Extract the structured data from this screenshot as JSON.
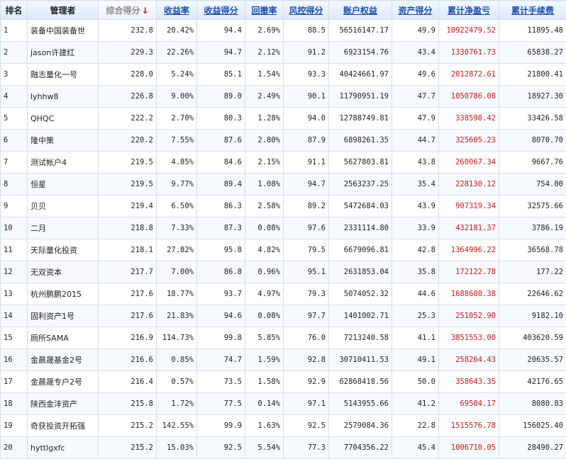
{
  "header": {
    "rank": "排名",
    "manager": "管理者",
    "score": "综合得分",
    "score_arrow": "↓",
    "return_rate": "收益率",
    "return_score": "收益得分",
    "drawdown": "回撤率",
    "risk_score": "风控得分",
    "equity": "账户权益",
    "asset_score": "资产得分",
    "net_pnl": "累计净盈亏",
    "fees": "累计手续费"
  },
  "rows": [
    {
      "rank": "1",
      "name": "装备中国装备世",
      "score": "232.8",
      "ret": "20.42%",
      "ret_score": "94.4",
      "dd": "2.69%",
      "risk": "88.5",
      "equity": "56516147.17",
      "asset": "49.9",
      "pnl": "10922479.52",
      "fee": "11895.48"
    },
    {
      "rank": "2",
      "name": "jason许建红",
      "score": "229.3",
      "ret": "22.26%",
      "ret_score": "94.7",
      "dd": "2.12%",
      "risk": "91.2",
      "equity": "6923154.76",
      "asset": "43.4",
      "pnl": "1330761.73",
      "fee": "65838.27"
    },
    {
      "rank": "3",
      "name": "融志量化一号",
      "score": "228.0",
      "ret": "5.24%",
      "ret_score": "85.1",
      "dd": "1.54%",
      "risk": "93.3",
      "equity": "40424661.97",
      "asset": "49.6",
      "pnl": "2012872.61",
      "fee": "21800.41"
    },
    {
      "rank": "4",
      "name": "lyhhw8",
      "score": "226.8",
      "ret": "9.00%",
      "ret_score": "89.0",
      "dd": "2.49%",
      "risk": "90.1",
      "equity": "11790951.19",
      "asset": "47.7",
      "pnl": "1050786.08",
      "fee": "18927.30"
    },
    {
      "rank": "5",
      "name": "QHQC",
      "score": "222.2",
      "ret": "2.70%",
      "ret_score": "80.3",
      "dd": "1.28%",
      "risk": "94.0",
      "equity": "12788749.81",
      "asset": "47.9",
      "pnl": "338598.42",
      "fee": "33426.58"
    },
    {
      "rank": "6",
      "name": "隆中策",
      "score": "220.2",
      "ret": "7.55%",
      "ret_score": "87.6",
      "dd": "2.80%",
      "risk": "87.9",
      "equity": "6898261.35",
      "asset": "44.7",
      "pnl": "325605.23",
      "fee": "8070.70"
    },
    {
      "rank": "7",
      "name": "测试帐户4",
      "score": "219.5",
      "ret": "4.85%",
      "ret_score": "84.6",
      "dd": "2.15%",
      "risk": "91.1",
      "equity": "5627803.81",
      "asset": "43.8",
      "pnl": "260067.34",
      "fee": "9667.76"
    },
    {
      "rank": "8",
      "name": "恒星",
      "score": "219.5",
      "ret": "9.77%",
      "ret_score": "89.4",
      "dd": "1.08%",
      "risk": "94.7",
      "equity": "2563237.25",
      "asset": "35.4",
      "pnl": "228130.12",
      "fee": "754.00"
    },
    {
      "rank": "9",
      "name": "贝贝",
      "score": "219.4",
      "ret": "6.50%",
      "ret_score": "86.3",
      "dd": "2.58%",
      "risk": "89.2",
      "equity": "5472684.03",
      "asset": "43.9",
      "pnl": "907319.34",
      "fee": "32575.66"
    },
    {
      "rank": "10",
      "name": "二月",
      "score": "218.8",
      "ret": "7.33%",
      "ret_score": "87.3",
      "dd": "0.08%",
      "risk": "97.6",
      "equity": "2331114.80",
      "asset": "33.9",
      "pnl": "432181.37",
      "fee": "3786.19"
    },
    {
      "rank": "11",
      "name": "天际量化投资",
      "score": "218.1",
      "ret": "27.82%",
      "ret_score": "95.8",
      "dd": "4.82%",
      "risk": "79.5",
      "equity": "6679096.81",
      "asset": "42.8",
      "pnl": "1364996.22",
      "fee": "36568.78"
    },
    {
      "rank": "12",
      "name": "无双资本",
      "score": "217.7",
      "ret": "7.00%",
      "ret_score": "86.8",
      "dd": "0.96%",
      "risk": "95.1",
      "equity": "2631853.04",
      "asset": "35.8",
      "pnl": "172122.78",
      "fee": "177.22"
    },
    {
      "rank": "13",
      "name": "杭州鹏鹏2015",
      "score": "217.6",
      "ret": "18.77%",
      "ret_score": "93.7",
      "dd": "4.97%",
      "risk": "79.3",
      "equity": "5074052.32",
      "asset": "44.6",
      "pnl": "1688608.38",
      "fee": "22646.62"
    },
    {
      "rank": "14",
      "name": "固利资产1号",
      "score": "217.6",
      "ret": "21.83%",
      "ret_score": "94.6",
      "dd": "0.08%",
      "risk": "97.7",
      "equity": "1401002.71",
      "asset": "25.3",
      "pnl": "251052.90",
      "fee": "9182.10"
    },
    {
      "rank": "15",
      "name": "厕所SAMA",
      "score": "216.9",
      "ret": "114.73%",
      "ret_score": "99.8",
      "dd": "5.85%",
      "risk": "76.0",
      "equity": "7213240.58",
      "asset": "41.1",
      "pnl": "3851553.00",
      "fee": "403620.59"
    },
    {
      "rank": "16",
      "name": "金晨晟基金2号",
      "score": "216.6",
      "ret": "0.85%",
      "ret_score": "74.7",
      "dd": "1.59%",
      "risk": "92.8",
      "equity": "30710411.53",
      "asset": "49.1",
      "pnl": "258264.43",
      "fee": "20635.57"
    },
    {
      "rank": "17",
      "name": "金晨晟专户2号",
      "score": "216.4",
      "ret": "0.57%",
      "ret_score": "73.5",
      "dd": "1.58%",
      "risk": "92.9",
      "equity": "62868418.56",
      "asset": "50.0",
      "pnl": "358643.35",
      "fee": "42176.65"
    },
    {
      "rank": "18",
      "name": "陕西金沣资产",
      "score": "215.8",
      "ret": "1.72%",
      "ret_score": "77.5",
      "dd": "0.14%",
      "risk": "97.1",
      "equity": "5143955.66",
      "asset": "41.2",
      "pnl": "69504.17",
      "fee": "8080.83"
    },
    {
      "rank": "19",
      "name": "奇获投资开拓强",
      "score": "215.2",
      "ret": "142.55%",
      "ret_score": "99.9",
      "dd": "1.63%",
      "risk": "92.5",
      "equity": "2579084.36",
      "asset": "22.8",
      "pnl": "1515576.78",
      "fee": "156025.40"
    },
    {
      "rank": "20",
      "name": "hyttlgxfc",
      "score": "215.2",
      "ret": "15.03%",
      "ret_score": "92.5",
      "dd": "5.54%",
      "risk": "77.3",
      "equity": "7704356.22",
      "asset": "45.4",
      "pnl": "1006710.05",
      "fee": "28490.27"
    }
  ]
}
